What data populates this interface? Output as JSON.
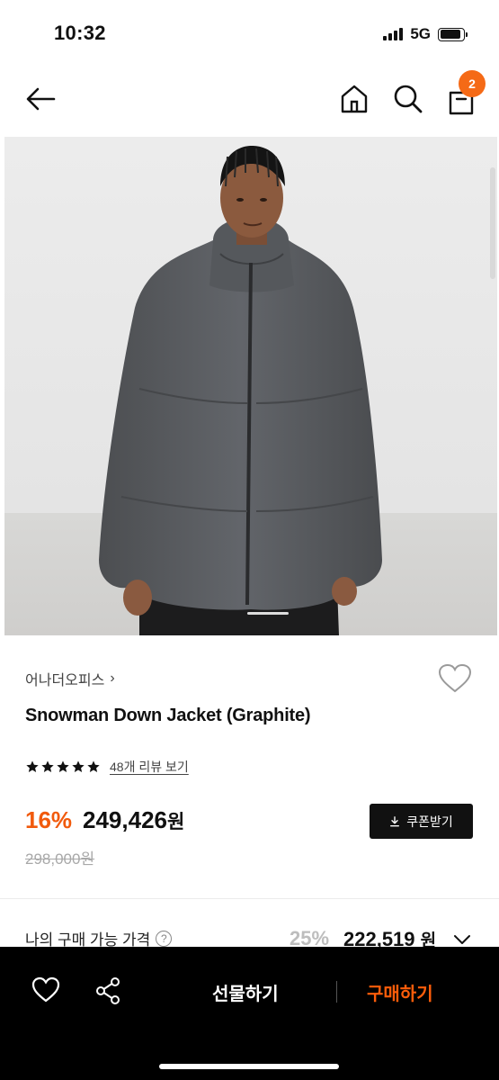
{
  "status_bar": {
    "time": "10:32",
    "network": "5G",
    "signal_icon": "signal-bars-icon",
    "battery_icon": "battery-icon",
    "battery_level": 0.9
  },
  "nav": {
    "back_icon": "arrow-left-icon",
    "home_icon": "home-icon",
    "search_icon": "search-icon",
    "bag_icon": "shopping-bag-icon",
    "cart_count": "2",
    "badge_color": "#f56a16"
  },
  "product": {
    "image_alt_icon": "product-photo",
    "brand": "어나더오피스",
    "brand_chevron": "›",
    "title": "Snowman Down Jacket (Graphite)",
    "rating_stars": 5,
    "review_link": "48개 리뷰 보기",
    "discount": "16%",
    "price": "249,426",
    "currency": "원",
    "original_price": "298,000원",
    "coupon_label": "쿠폰받기",
    "accent_color": "#f15a0c"
  },
  "my_price": {
    "label": "나의 구매 가능 가격",
    "help_glyph": "?",
    "discount": "25%",
    "price": "222,519",
    "currency": "원"
  },
  "bottom_bar": {
    "gift_label": "선물하기",
    "buy_label": "구매하기",
    "buy_color": "#ff5d0a"
  }
}
